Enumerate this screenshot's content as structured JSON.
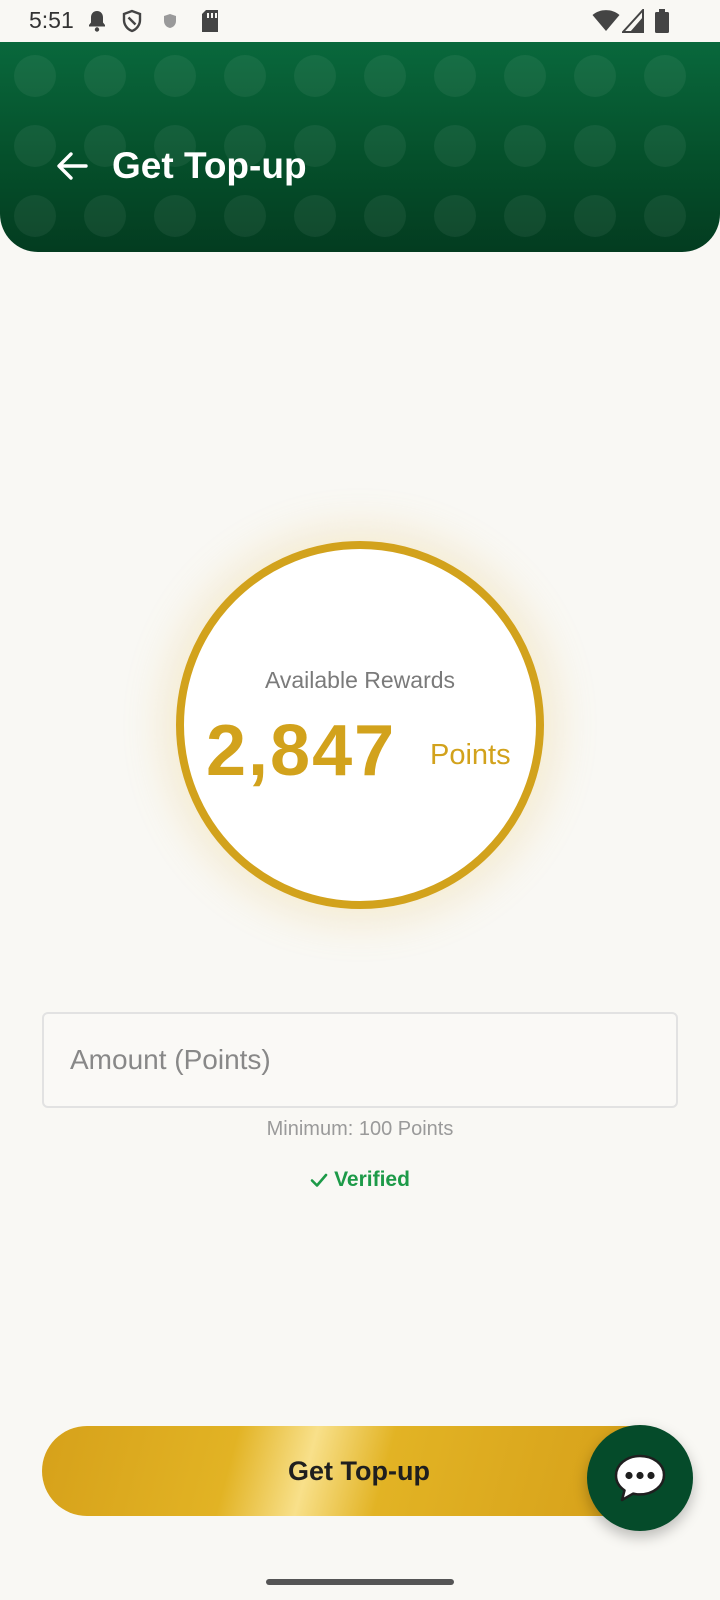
{
  "status_bar": {
    "time": "5:51",
    "icons_left": [
      "notification-bell-icon",
      "shield-icon",
      "small-shield-icon",
      "sd-card-icon"
    ],
    "icons_right": [
      "wifi-icon",
      "cell-signal-icon",
      "battery-icon"
    ]
  },
  "header": {
    "title": "Get Top-up",
    "back_icon": "arrow-left-icon"
  },
  "rewards": {
    "label": "Available Rewards",
    "value": "2,847",
    "unit": "Points"
  },
  "amount": {
    "placeholder": "Amount (Points)",
    "value": "",
    "minimum_hint": "Minimum: 100 Points",
    "verified_label": "Verified"
  },
  "actions": {
    "submit_label": "Get Top-up",
    "chat_icon": "chat-bubble-icon"
  },
  "colors": {
    "header_green": "#05502b",
    "gold": "#d2a21c",
    "verified_green": "#1d9a48",
    "background": "#f9f8f4"
  }
}
